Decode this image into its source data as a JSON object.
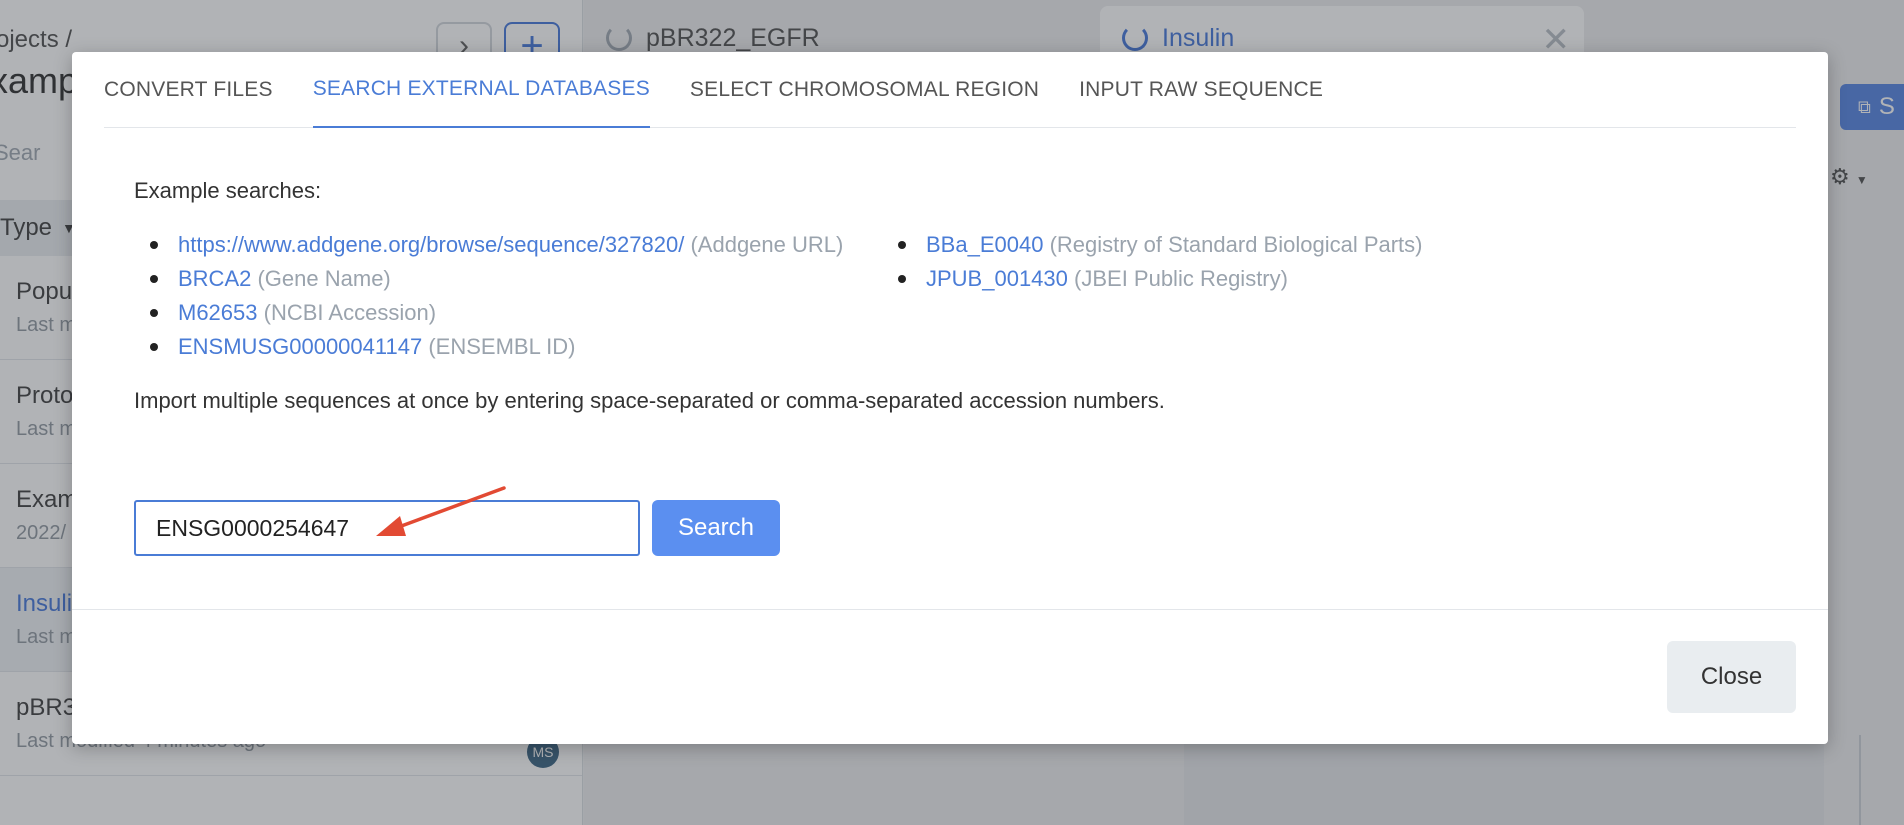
{
  "background": {
    "breadcrumb": "ojects /",
    "project_title": "xampl",
    "search_placeholder": "Sear",
    "type_filter_label": "Type",
    "list_items": [
      {
        "name": "Popu",
        "meta": "Last m"
      },
      {
        "name": "Proto",
        "meta": "Last m"
      },
      {
        "name": "Exam",
        "meta": "2022/"
      },
      {
        "name": "Insuli",
        "meta": "Last m"
      },
      {
        "name": "pBR3",
        "meta": "Last modified 4 minutes ago",
        "avatar": "MS"
      }
    ],
    "doc_tabs": [
      "pBR322_EGFR",
      "Insulin"
    ],
    "share_label": "S"
  },
  "modal": {
    "tabs": [
      "CONVERT FILES",
      "SEARCH EXTERNAL DATABASES",
      "SELECT CHROMOSOMAL REGION",
      "INPUT RAW SEQUENCE"
    ],
    "active_tab": "SEARCH EXTERNAL DATABASES",
    "examples_label": "Example searches:",
    "examples_left": [
      {
        "link": "https://www.addgene.org/browse/sequence/327820/",
        "note": "(Addgene URL)"
      },
      {
        "link": "BRCA2",
        "note": "(Gene Name)"
      },
      {
        "link": "M62653",
        "note": "(NCBI Accession)"
      },
      {
        "link": "ENSMUSG00000041147",
        "note": "(ENSEMBL ID)"
      }
    ],
    "examples_right": [
      {
        "link": "BBa_E0040",
        "note": "(Registry of Standard Biological Parts)"
      },
      {
        "link": "JPUB_001430",
        "note": "(JBEI Public Registry)"
      }
    ],
    "multi_text": "Import multiple sequences at once by entering space-separated or comma-separated accession numbers.",
    "search_input_value": "ENSG0000254647",
    "search_button": "Search",
    "close_button": "Close"
  },
  "colors": {
    "accent": "#4a7cd6",
    "button_primary": "#5b8ff0",
    "annotation_arrow": "#e24a33"
  }
}
